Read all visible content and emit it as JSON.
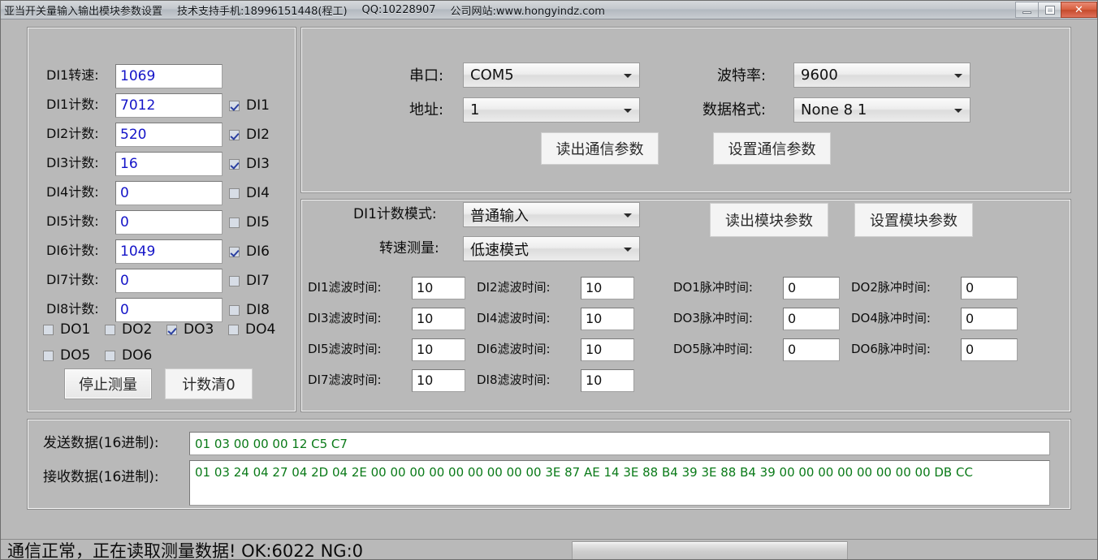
{
  "window": {
    "title": "亚当开关量输入输出模块参数设置",
    "support": "技术支持手机:18996151448(程工)",
    "qq": "QQ:10228907",
    "site": "公司网站:www.hongyindz.com",
    "minimize_label": "minimize",
    "maximize_label": "maximize",
    "close_label": "✕"
  },
  "measure_panel": {
    "rows": [
      {
        "label": "DI1转速:",
        "value": "1069",
        "check_label": "",
        "checked": null
      },
      {
        "label": "DI1计数:",
        "value": "7012",
        "check_label": "DI1",
        "checked": true
      },
      {
        "label": "DI2计数:",
        "value": "520",
        "check_label": "DI2",
        "checked": true
      },
      {
        "label": "DI3计数:",
        "value": "16",
        "check_label": "DI3",
        "checked": true
      },
      {
        "label": "DI4计数:",
        "value": "0",
        "check_label": "DI4",
        "checked": false
      },
      {
        "label": "DI5计数:",
        "value": "0",
        "check_label": "DI5",
        "checked": false
      },
      {
        "label": "DI6计数:",
        "value": "1049",
        "check_label": "DI6",
        "checked": true
      },
      {
        "label": "DI7计数:",
        "value": "0",
        "check_label": "DI7",
        "checked": false
      },
      {
        "label": "DI8计数:",
        "value": "0",
        "check_label": "DI8",
        "checked": false
      }
    ],
    "do_checks": [
      {
        "label": "DO1",
        "checked": false
      },
      {
        "label": "DO2",
        "checked": false
      },
      {
        "label": "DO3",
        "checked": true
      },
      {
        "label": "DO4",
        "checked": false
      },
      {
        "label": "DO5",
        "checked": false
      },
      {
        "label": "DO6",
        "checked": false
      }
    ],
    "stop_button": "停止测量",
    "clear_button": "计数清0"
  },
  "comm_panel": {
    "port_label": "串口:",
    "port_value": "COM5",
    "addr_label": "地址:",
    "addr_value": "1",
    "baud_label": "波特率:",
    "baud_value": "9600",
    "format_label": "数据格式:",
    "format_value": "None 8 1",
    "read_button": "读出通信参数",
    "set_button": "设置通信参数"
  },
  "module_panel": {
    "di1_mode_label": "DI1计数模式:",
    "di1_mode_value": "普通输入",
    "speed_mode_label": "转速测量:",
    "speed_mode_value": "低速模式",
    "read_button": "读出模块参数",
    "set_button": "设置模块参数",
    "filters": [
      {
        "label": "DI1滤波时间:",
        "value": "10"
      },
      {
        "label": "DI2滤波时间:",
        "value": "10"
      },
      {
        "label": "DI3滤波时间:",
        "value": "10"
      },
      {
        "label": "DI4滤波时间:",
        "value": "10"
      },
      {
        "label": "DI5滤波时间:",
        "value": "10"
      },
      {
        "label": "DI6滤波时间:",
        "value": "10"
      },
      {
        "label": "DI7滤波时间:",
        "value": "10"
      },
      {
        "label": "DI8滤波时间:",
        "value": "10"
      }
    ],
    "pulses": [
      {
        "label": "DO1脉冲时间:",
        "value": "0"
      },
      {
        "label": "DO2脉冲时间:",
        "value": "0"
      },
      {
        "label": "DO3脉冲时间:",
        "value": "0"
      },
      {
        "label": "DO4脉冲时间:",
        "value": "0"
      },
      {
        "label": "DO5脉冲时间:",
        "value": "0"
      },
      {
        "label": "DO6脉冲时间:",
        "value": "0"
      }
    ]
  },
  "data_panel": {
    "send_label": "发送数据(16进制):",
    "send_value": "01 03 00 00 00 12 C5 C7",
    "recv_label": "接收数据(16进制):",
    "recv_value": "01 03 24 04 27 04 2D 04 2E 00 00 00 00 00 00 00 00 00 3E 87 AE 14 3E 88 B4 39 3E 88 B4 39 00 00 00 00 00 00 00 00 DB CC"
  },
  "status": {
    "text": "通信正常，正在读取测量数据! OK:6022  NG:0",
    "progress_percent": 0
  },
  "colors": {
    "value_blue": "#1414c8",
    "hex_green": "#0a7a18",
    "background": "#b9b9b9"
  }
}
